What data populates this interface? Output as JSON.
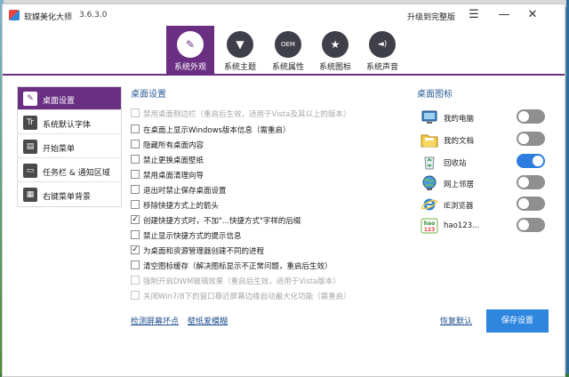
{
  "app": {
    "title": "软媒美化大师",
    "version": "3.6.3.0",
    "upgrade_label": "升级到完整版"
  },
  "window_controls": {
    "menu": "☰",
    "minimize": "—",
    "close": "✕"
  },
  "toolbar": [
    {
      "label": "系统外观",
      "icon": "brush-icon",
      "glyph": "✎",
      "active": true
    },
    {
      "label": "系统主题",
      "icon": "shirt-icon",
      "glyph": "▼",
      "active": false
    },
    {
      "label": "系统属性",
      "icon": "oem-icon",
      "glyph": "OEM",
      "active": false
    },
    {
      "label": "系统图标",
      "icon": "star-icon",
      "glyph": "★",
      "active": false
    },
    {
      "label": "系统声音",
      "icon": "speaker-icon",
      "glyph": "◄)",
      "active": false
    }
  ],
  "sidebar": [
    {
      "label": "桌面设置",
      "glyph": "✎",
      "active": true
    },
    {
      "label": "系统默认字体",
      "glyph": "Tr",
      "active": false
    },
    {
      "label": "开始菜单",
      "glyph": "▤",
      "active": false
    },
    {
      "label": "任务栏 & 通知区域",
      "glyph": "▭",
      "active": false
    },
    {
      "label": "右键菜单背景",
      "glyph": "▦",
      "active": false
    }
  ],
  "desktop_settings": {
    "title": "桌面设置",
    "options": [
      {
        "label": "禁用桌面侧边栏（重启后生效，适用于Vista及其以上的版本）",
        "checked": false,
        "disabled": true
      },
      {
        "label": "在桌面上显示Windows版本信息（需重启）",
        "checked": false,
        "disabled": false
      },
      {
        "label": "隐藏所有桌面内容",
        "checked": false,
        "disabled": false
      },
      {
        "label": "禁止更换桌面壁纸",
        "checked": false,
        "disabled": false
      },
      {
        "label": "禁用桌面清理向导",
        "checked": false,
        "disabled": false
      },
      {
        "label": "退出时禁止保存桌面设置",
        "checked": false,
        "disabled": false
      },
      {
        "label": "移除快捷方式上的箭头",
        "checked": false,
        "disabled": false
      },
      {
        "label": "创建快捷方式时，不加\"...快捷方式\"字样的后缀",
        "checked": true,
        "disabled": false
      },
      {
        "label": "禁止显示快捷方式的提示信息",
        "checked": false,
        "disabled": false
      },
      {
        "label": "为桌面和资源管理器创建不同的进程",
        "checked": true,
        "disabled": false
      },
      {
        "label": "清空图标缓存（解决图标显示不正常问题，重启后生效）",
        "checked": false,
        "disabled": false
      },
      {
        "label": "强制开启DWM玻璃效果（重启后生效，适用于Vista版本）",
        "checked": false,
        "disabled": true
      },
      {
        "label": "关闭Win7/8下的窗口靠近屏幕边缘自动最大化功能（需重启）",
        "checked": false,
        "disabled": true
      }
    ],
    "links": {
      "detect": "检测屏幕坏点",
      "wallpaper": "壁纸爱模糊"
    }
  },
  "desktop_icons": {
    "title": "桌面图标",
    "items": [
      {
        "label": "我的电脑",
        "icon": "computer-icon",
        "on": false
      },
      {
        "label": "我的文档",
        "icon": "documents-icon",
        "on": false
      },
      {
        "label": "回收站",
        "icon": "recycle-bin-icon",
        "on": true
      },
      {
        "label": "网上邻居",
        "icon": "network-icon",
        "on": false
      },
      {
        "label": "IE浏览器",
        "icon": "ie-icon",
        "on": false
      },
      {
        "label": "hao123...",
        "icon": "hao123-icon",
        "on": false
      }
    ],
    "icon_glyphs": {
      "hao123": "hao\n123"
    }
  },
  "actions": {
    "reset": "恢复默认",
    "save": "保存设置"
  },
  "colors": {
    "accent": "#6a2f82",
    "link": "#1f4f8f",
    "save_button": "#2e86de",
    "toggle_on": "#2d7de0",
    "toggle_off": "#8f8f8f"
  }
}
